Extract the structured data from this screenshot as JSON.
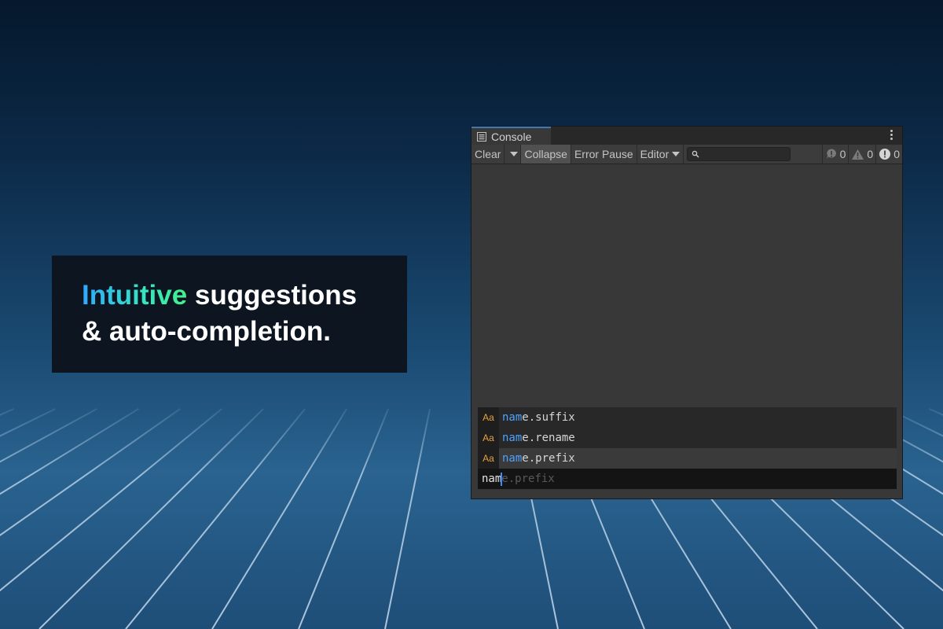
{
  "promo": {
    "highlight": "Intuitive",
    "line1_rest": " suggestions",
    "line2": "& auto-completion."
  },
  "console": {
    "tab_title": "Console",
    "tab_icon": "console-list-icon",
    "toolbar": {
      "clear": "Clear",
      "collapse": "Collapse",
      "error_pause": "Error Pause",
      "editor": "Editor",
      "search_value": "",
      "info_count": "0",
      "warning_count": "0",
      "error_count": "0"
    },
    "suggestions": [
      {
        "type": "Aa",
        "match": "nam",
        "rest": "e.suffix",
        "selected": false
      },
      {
        "type": "Aa",
        "match": "nam",
        "rest": "e.rename",
        "selected": false
      },
      {
        "type": "Aa",
        "match": "nam",
        "rest": "e.prefix",
        "selected": true
      }
    ],
    "input": {
      "typed": "nam",
      "ghost": "e.prefix"
    }
  },
  "colors": {
    "accent_gradient_start": "#2fa8ff",
    "accent_gradient_end": "#45f08c",
    "match_highlight": "#4da2ff",
    "type_badge": "#e8a13f"
  }
}
